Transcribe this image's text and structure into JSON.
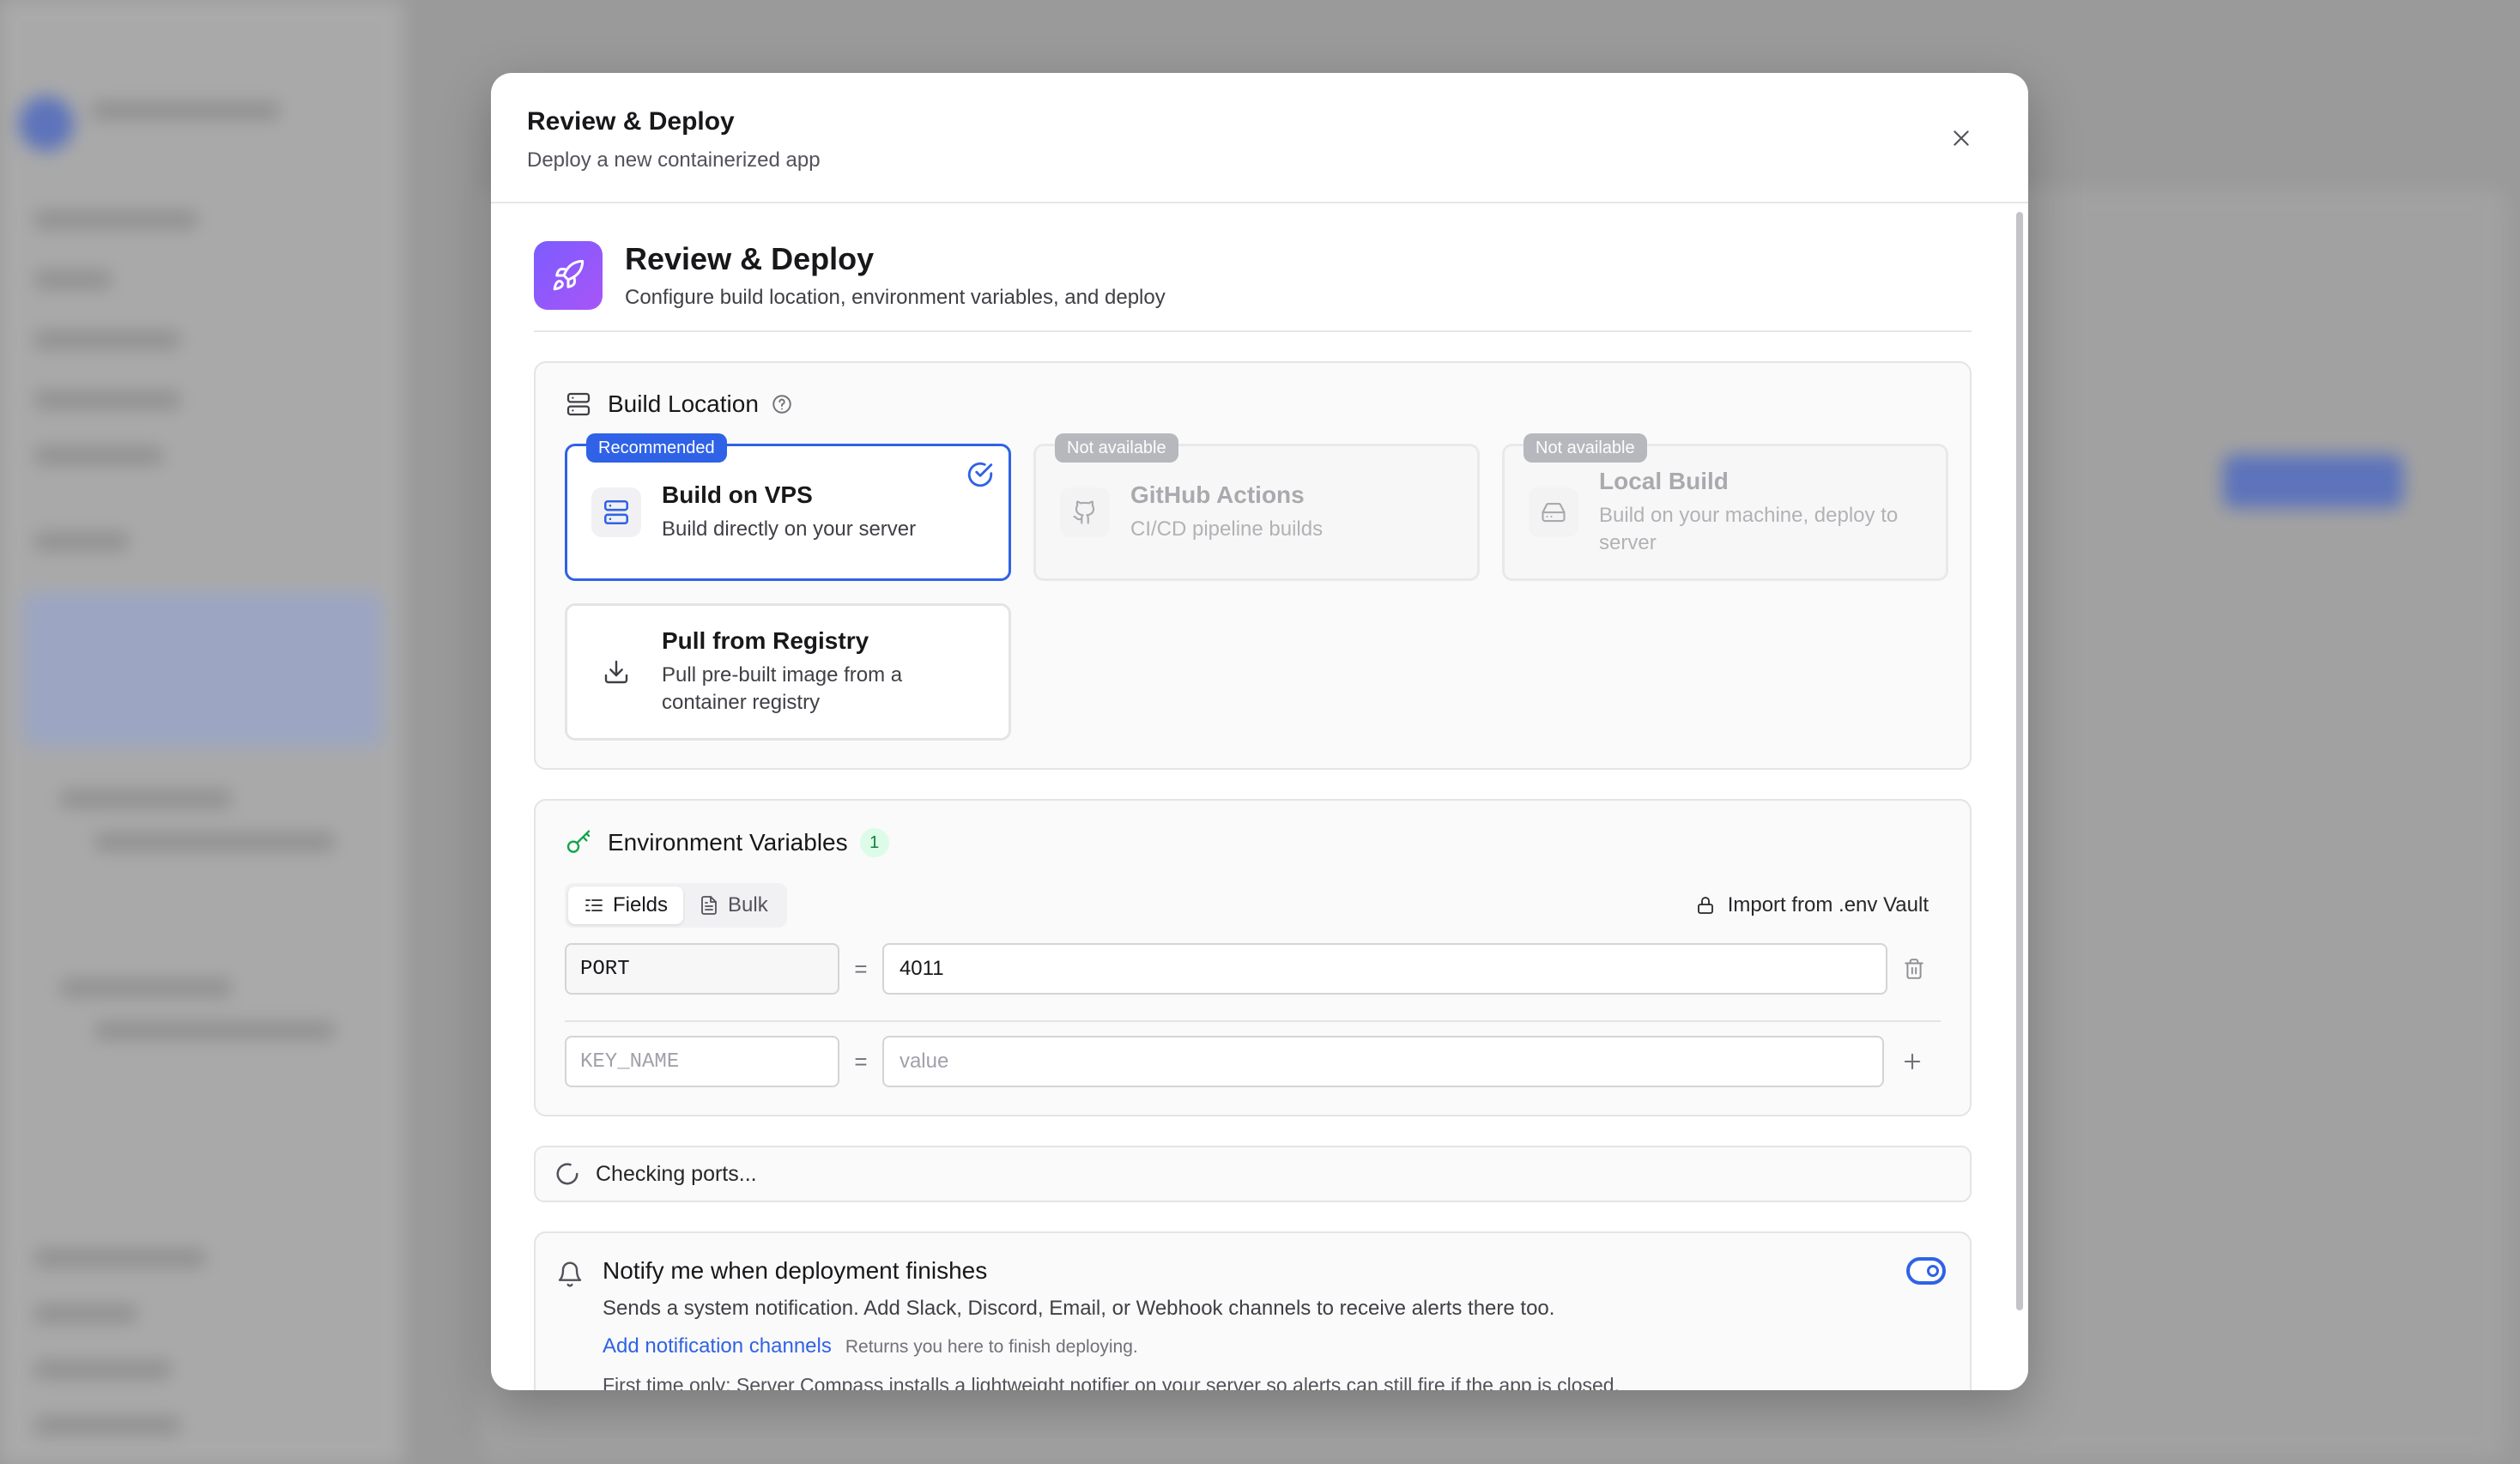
{
  "modal": {
    "title": "Review & Deploy",
    "subtitle": "Deploy a new containerized app"
  },
  "hero": {
    "title": "Review & Deploy",
    "subtitle": "Configure build location, environment variables, and deploy",
    "icon": "rocket-icon"
  },
  "build_location": {
    "title": "Build Location",
    "options": [
      {
        "title": "Build on VPS",
        "description": "Build directly on your server",
        "badge": "Recommended",
        "selected": true,
        "available": true,
        "icon": "server-icon"
      },
      {
        "title": "GitHub Actions",
        "description": "CI/CD pipeline builds",
        "badge": "Not available",
        "selected": false,
        "available": false,
        "icon": "github-icon"
      },
      {
        "title": "Local Build",
        "description": "Build on your machine, deploy to server",
        "badge": "Not available",
        "selected": false,
        "available": false,
        "icon": "hard-drive-icon"
      },
      {
        "title": "Pull from Registry",
        "description": "Pull pre-built image from a container registry",
        "badge": "",
        "selected": false,
        "available": true,
        "icon": "download-icon"
      }
    ]
  },
  "env": {
    "title": "Environment Variables",
    "count": "1",
    "tabs": {
      "fields": "Fields",
      "bulk": "Bulk"
    },
    "vault_label": "Import from .env Vault",
    "vars": [
      {
        "key": "PORT",
        "value": "4011"
      }
    ],
    "new_key_placeholder": "KEY_NAME",
    "new_value_placeholder": "value",
    "equals": "="
  },
  "status": {
    "text": "Checking ports..."
  },
  "notify": {
    "title": "Notify me when deployment finishes",
    "description": "Sends a system notification. Add Slack, Discord, Email, or Webhook channels to receive alerts there too.",
    "link": "Add notification channels",
    "hint": "Returns you here to finish deploying.",
    "note": "First time only: Server Compass installs a lightweight notifier on your server so alerts can still fire if the app is closed.",
    "enabled": true
  },
  "colors": {
    "accent": "#2f62e6",
    "success": "#16a34a",
    "hero_gradient_start": "#7c5cff",
    "hero_gradient_end": "#a855f7"
  }
}
